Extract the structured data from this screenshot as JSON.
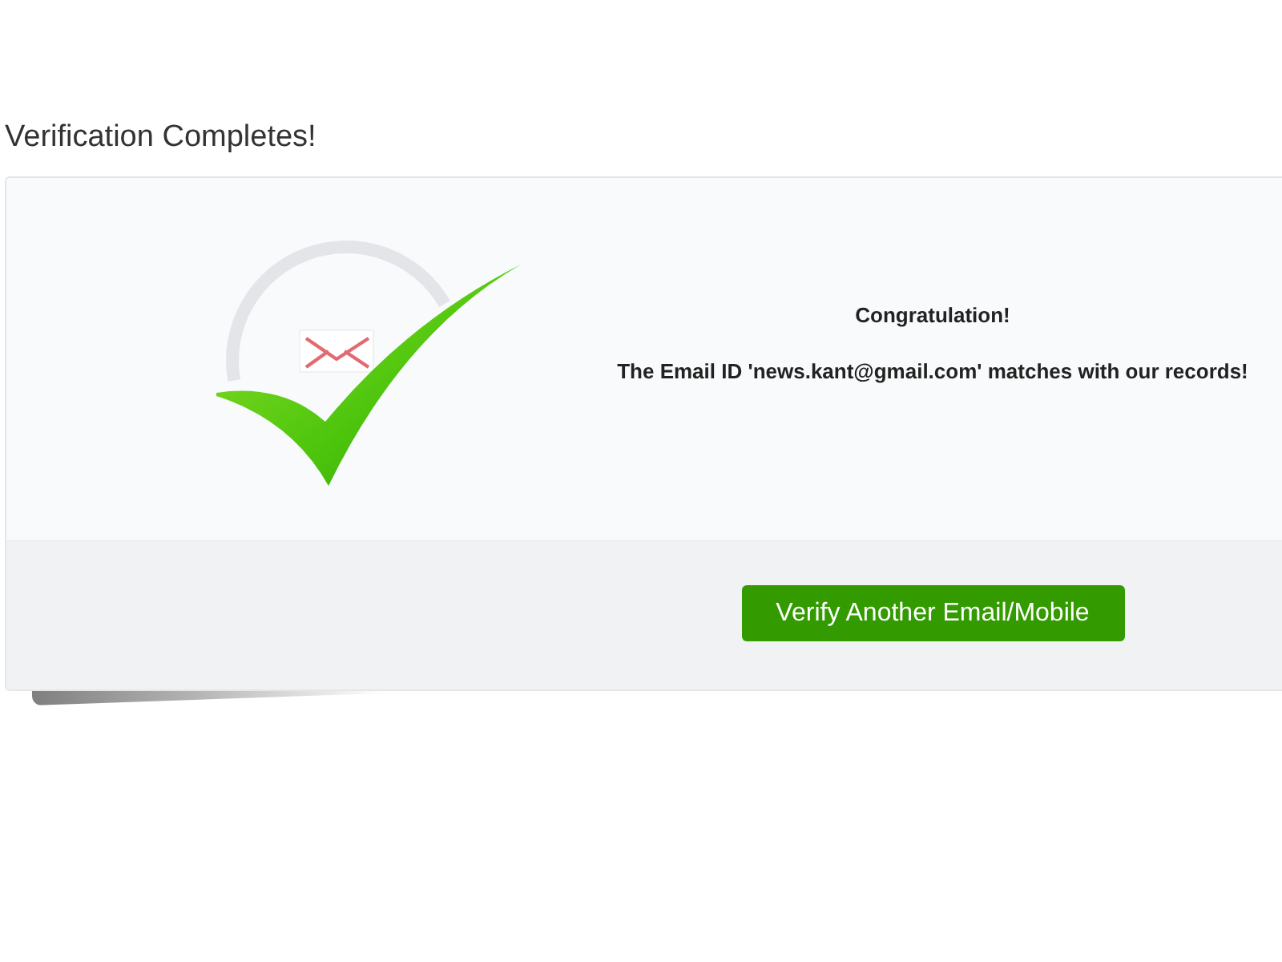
{
  "page": {
    "title": "Verification Completes!"
  },
  "result": {
    "heading": "Congratulation!",
    "message": "The Email ID 'news.kant@gmail.com' matches with our records!"
  },
  "action": {
    "label": "Verify Another Email/Mobile"
  }
}
